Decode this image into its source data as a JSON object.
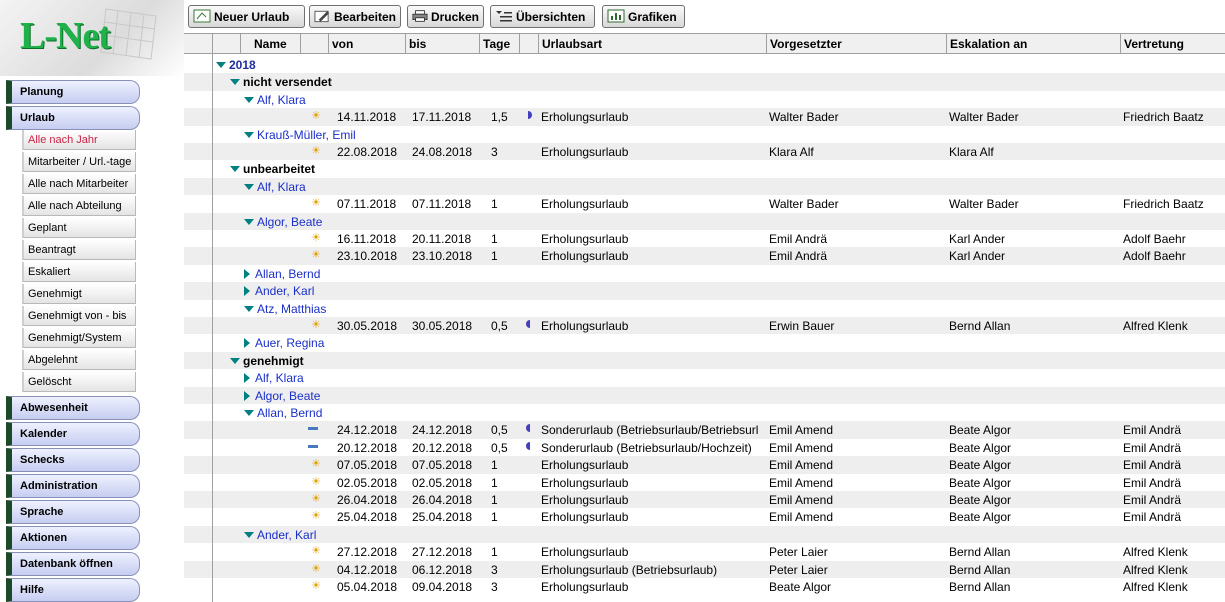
{
  "logo": {
    "text": "L-Net"
  },
  "sidebar": {
    "main_top": [
      {
        "label": "Planung"
      },
      {
        "label": "Urlaub"
      }
    ],
    "sub": [
      {
        "label": "Alle nach Jahr",
        "active": true
      },
      {
        "label": "Mitarbeiter / Url.-tage"
      },
      {
        "label": "Alle nach Mitarbeiter"
      },
      {
        "label": "Alle nach Abteilung"
      },
      {
        "label": "Geplant"
      },
      {
        "label": "Beantragt"
      },
      {
        "label": "Eskaliert"
      },
      {
        "label": "Genehmigt"
      },
      {
        "label": "Genehmigt von - bis"
      },
      {
        "label": "Genehmigt/System"
      },
      {
        "label": "Abgelehnt"
      },
      {
        "label": "Gelöscht"
      }
    ],
    "main_bottom": [
      {
        "label": "Abwesenheit"
      },
      {
        "label": "Kalender"
      },
      {
        "label": "Schecks"
      },
      {
        "label": "Administration"
      },
      {
        "label": "Sprache"
      },
      {
        "label": "Aktionen"
      },
      {
        "label": "Datenbank öffnen"
      },
      {
        "label": "Hilfe"
      }
    ]
  },
  "toolbar": {
    "new_label": "Neuer Urlaub",
    "edit_label": "Bearbeiten",
    "print_label": "Drucken",
    "overview_label": "Übersichten",
    "graphics_label": "Grafiken"
  },
  "columns": {
    "name": "Name",
    "von": "von",
    "bis": "bis",
    "tage": "Tage",
    "urlaubsart": "Urlaubsart",
    "vorgesetzter": "Vorgesetzter",
    "eskalation": "Eskalation an",
    "vertretung": "Vertretung"
  },
  "rows": [
    {
      "kind": "year",
      "label": "2018"
    },
    {
      "kind": "status",
      "label": "nicht versendet"
    },
    {
      "kind": "person",
      "label": "Alf, Klara",
      "expanded": true
    },
    {
      "kind": "entry",
      "icon": "sun",
      "von": "14.11.2018",
      "bis": "17.11.2018",
      "tage": "1,5",
      "half": "right",
      "art": "Erholungsurlaub",
      "vorg": "Walter Bader",
      "esk": "Walter Bader",
      "vert": "Friedrich Baatz"
    },
    {
      "kind": "person",
      "label": "Krauß-Müller, Emil",
      "expanded": true
    },
    {
      "kind": "entry",
      "icon": "sun",
      "von": "22.08.2018",
      "bis": "24.08.2018",
      "tage": "3",
      "half": "",
      "art": "Erholungsurlaub",
      "vorg": "Klara Alf",
      "esk": "Klara Alf",
      "vert": ""
    },
    {
      "kind": "status",
      "label": "unbearbeitet"
    },
    {
      "kind": "person",
      "label": "Alf, Klara",
      "expanded": true
    },
    {
      "kind": "entry",
      "icon": "sun",
      "von": "07.11.2018",
      "bis": "07.11.2018",
      "tage": "1",
      "half": "",
      "art": "Erholungsurlaub",
      "vorg": "Walter Bader",
      "esk": "Walter Bader",
      "vert": "Friedrich Baatz"
    },
    {
      "kind": "person",
      "label": "Algor, Beate",
      "expanded": true
    },
    {
      "kind": "entry",
      "icon": "sun",
      "von": "16.11.2018",
      "bis": "20.11.2018",
      "tage": "1",
      "half": "",
      "art": "Erholungsurlaub",
      "vorg": "Emil Andrä",
      "esk": "Karl Ander",
      "vert": "Adolf Baehr"
    },
    {
      "kind": "entry",
      "icon": "sun",
      "von": "23.10.2018",
      "bis": "23.10.2018",
      "tage": "1",
      "half": "",
      "art": "Erholungsurlaub",
      "vorg": "Emil Andrä",
      "esk": "Karl Ander",
      "vert": "Adolf Baehr"
    },
    {
      "kind": "person",
      "label": "Allan, Bernd",
      "expanded": false
    },
    {
      "kind": "person",
      "label": "Ander, Karl",
      "expanded": false
    },
    {
      "kind": "person",
      "label": "Atz, Matthias",
      "expanded": true
    },
    {
      "kind": "entry",
      "icon": "sun",
      "von": "30.05.2018",
      "bis": "30.05.2018",
      "tage": "0,5",
      "half": "left",
      "art": "Erholungsurlaub",
      "vorg": "Erwin Bauer",
      "esk": "Bernd Allan",
      "vert": "Alfred Klenk"
    },
    {
      "kind": "person",
      "label": "Auer, Regina",
      "expanded": false
    },
    {
      "kind": "status",
      "label": "genehmigt"
    },
    {
      "kind": "person",
      "label": "Alf, Klara",
      "expanded": false
    },
    {
      "kind": "person",
      "label": "Algor, Beate",
      "expanded": false
    },
    {
      "kind": "person",
      "label": "Allan, Bernd",
      "expanded": true
    },
    {
      "kind": "entry",
      "icon": "car",
      "von": "24.12.2018",
      "bis": "24.12.2018",
      "tage": "0,5",
      "half": "left",
      "art": "Sonderurlaub (Betriebsurlaub/Betriebsurl",
      "vorg": "Emil Amend",
      "esk": "Beate Algor",
      "vert": "Emil Andrä"
    },
    {
      "kind": "entry",
      "icon": "car",
      "von": "20.12.2018",
      "bis": "20.12.2018",
      "tage": "0,5",
      "half": "left",
      "art": "Sonderurlaub (Betriebsurlaub/Hochzeit)",
      "vorg": "Emil Amend",
      "esk": "Beate Algor",
      "vert": "Emil Andrä"
    },
    {
      "kind": "entry",
      "icon": "sun",
      "von": "07.05.2018",
      "bis": "07.05.2018",
      "tage": "1",
      "half": "",
      "art": "Erholungsurlaub",
      "vorg": "Emil Amend",
      "esk": "Beate Algor",
      "vert": "Emil Andrä"
    },
    {
      "kind": "entry",
      "icon": "sun",
      "von": "02.05.2018",
      "bis": "02.05.2018",
      "tage": "1",
      "half": "",
      "art": "Erholungsurlaub",
      "vorg": "Emil Amend",
      "esk": "Beate Algor",
      "vert": "Emil Andrä"
    },
    {
      "kind": "entry",
      "icon": "sun",
      "von": "26.04.2018",
      "bis": "26.04.2018",
      "tage": "1",
      "half": "",
      "art": "Erholungsurlaub",
      "vorg": "Emil Amend",
      "esk": "Beate Algor",
      "vert": "Emil Andrä"
    },
    {
      "kind": "entry",
      "icon": "sun",
      "von": "25.04.2018",
      "bis": "25.04.2018",
      "tage": "1",
      "half": "",
      "art": "Erholungsurlaub",
      "vorg": "Emil Amend",
      "esk": "Beate Algor",
      "vert": "Emil Andrä"
    },
    {
      "kind": "person",
      "label": "Ander, Karl",
      "expanded": true
    },
    {
      "kind": "entry",
      "icon": "sun",
      "von": "27.12.2018",
      "bis": "27.12.2018",
      "tage": "1",
      "half": "",
      "art": "Erholungsurlaub",
      "vorg": "Peter Laier",
      "esk": "Bernd Allan",
      "vert": "Alfred Klenk"
    },
    {
      "kind": "entry",
      "icon": "sun",
      "von": "04.12.2018",
      "bis": "06.12.2018",
      "tage": "3",
      "half": "",
      "art": "Erholungsurlaub (Betriebsurlaub)",
      "vorg": "Peter Laier",
      "esk": "Bernd Allan",
      "vert": "Alfred Klenk"
    },
    {
      "kind": "entry",
      "icon": "sun",
      "von": "05.04.2018",
      "bis": "09.04.2018",
      "tage": "3",
      "half": "",
      "art": "Erholungsurlaub",
      "vorg": "Beate Algor",
      "esk": "Bernd Allan",
      "vert": "Alfred Klenk"
    }
  ]
}
